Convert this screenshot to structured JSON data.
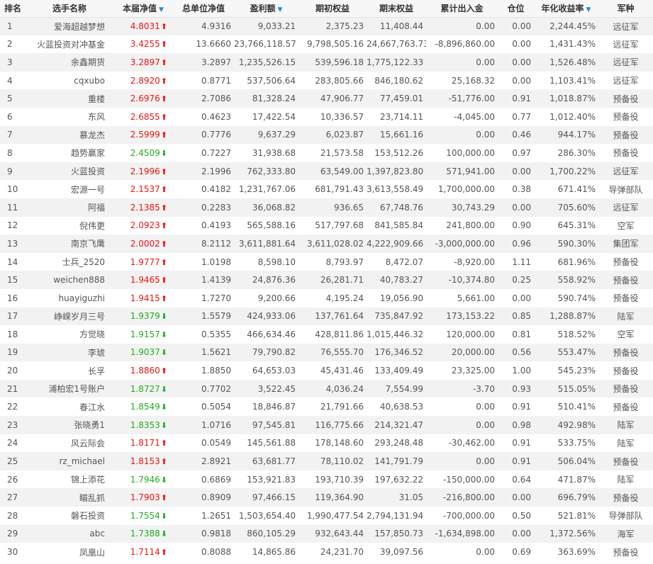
{
  "colors": {
    "up": "#ee1111",
    "down": "#22aa22",
    "sort_accent": "#1b8be0"
  },
  "headers": [
    {
      "label": "排名",
      "sortable": false
    },
    {
      "label": "选手名称",
      "sortable": false
    },
    {
      "label": "本届净值",
      "sortable": true
    },
    {
      "label": "总单位净值",
      "sortable": false
    },
    {
      "label": "盈利额",
      "sortable": true
    },
    {
      "label": "期初权益",
      "sortable": false
    },
    {
      "label": "期末权益",
      "sortable": false
    },
    {
      "label": "累计出入金",
      "sortable": false
    },
    {
      "label": "仓位",
      "sortable": false
    },
    {
      "label": "年化收益率",
      "sortable": true
    },
    {
      "label": "军种",
      "sortable": false
    }
  ],
  "rows": [
    {
      "rank": "1",
      "name": "爱海超越梦想",
      "nav": "4.8031",
      "dir": "up",
      "unit_nav": "4.9316",
      "profit": "9,033.21",
      "start_equity": "2,375.23",
      "end_equity": "11,408.44",
      "cum_flow": "0.00",
      "position": "0.00",
      "annual_return": "2,244.45%",
      "army": "远征军"
    },
    {
      "rank": "2",
      "name": "火蓝投资对冲基金",
      "nav": "3.4255",
      "dir": "up",
      "unit_nav": "13.6660",
      "profit": "23,766,118.57",
      "start_equity": "9,798,505.16",
      "end_equity": "24,667,763.73",
      "cum_flow": "-8,896,860.00",
      "position": "0.00",
      "annual_return": "1,431.43%",
      "army": "远征军"
    },
    {
      "rank": "3",
      "name": "余鑫期货",
      "nav": "3.2897",
      "dir": "up",
      "unit_nav": "3.2897",
      "profit": "1,235,526.15",
      "start_equity": "539,596.18",
      "end_equity": "1,775,122.33",
      "cum_flow": "0.00",
      "position": "0.00",
      "annual_return": "1,526.48%",
      "army": "远征军"
    },
    {
      "rank": "4",
      "name": "cqxubo",
      "nav": "2.8920",
      "dir": "up",
      "unit_nav": "0.8771",
      "profit": "537,506.64",
      "start_equity": "283,805.66",
      "end_equity": "846,180.62",
      "cum_flow": "25,168.32",
      "position": "0.00",
      "annual_return": "1,103.41%",
      "army": "远征军"
    },
    {
      "rank": "5",
      "name": "重楼",
      "nav": "2.6976",
      "dir": "up",
      "unit_nav": "2.7086",
      "profit": "81,328.24",
      "start_equity": "47,906.77",
      "end_equity": "77,459.01",
      "cum_flow": "-51,776.00",
      "position": "0.91",
      "annual_return": "1,018.87%",
      "army": "预备役"
    },
    {
      "rank": "6",
      "name": "东风",
      "nav": "2.6855",
      "dir": "up",
      "unit_nav": "0.4623",
      "profit": "17,422.54",
      "start_equity": "10,336.57",
      "end_equity": "23,714.11",
      "cum_flow": "-4,045.00",
      "position": "0.77",
      "annual_return": "1,012.40%",
      "army": "预备役"
    },
    {
      "rank": "7",
      "name": "慕龙杰",
      "nav": "2.5999",
      "dir": "up",
      "unit_nav": "0.7776",
      "profit": "9,637.29",
      "start_equity": "6,023.87",
      "end_equity": "15,661.16",
      "cum_flow": "0.00",
      "position": "0.46",
      "annual_return": "944.17%",
      "army": "预备役"
    },
    {
      "rank": "8",
      "name": "趋势赢家",
      "nav": "2.4509",
      "dir": "down",
      "unit_nav": "0.7227",
      "profit": "31,938.68",
      "start_equity": "21,573.58",
      "end_equity": "153,512.26",
      "cum_flow": "100,000.00",
      "position": "0.97",
      "annual_return": "286.30%",
      "army": "预备役"
    },
    {
      "rank": "9",
      "name": "火蓝投资",
      "nav": "2.1996",
      "dir": "up",
      "unit_nav": "2.1996",
      "profit": "762,333.80",
      "start_equity": "63,549.00",
      "end_equity": "1,397,823.80",
      "cum_flow": "571,941.00",
      "position": "0.00",
      "annual_return": "1,700.22%",
      "army": "远征军"
    },
    {
      "rank": "10",
      "name": "宏源一号",
      "nav": "2.1537",
      "dir": "up",
      "unit_nav": "0.4182",
      "profit": "1,231,767.06",
      "start_equity": "681,791.43",
      "end_equity": "3,613,558.49",
      "cum_flow": "1,700,000.00",
      "position": "0.38",
      "annual_return": "671.41%",
      "army": "导弹部队"
    },
    {
      "rank": "11",
      "name": "阿福",
      "nav": "2.1385",
      "dir": "up",
      "unit_nav": "0.2283",
      "profit": "36,068.82",
      "start_equity": "936.65",
      "end_equity": "67,748.76",
      "cum_flow": "30,743.29",
      "position": "0.00",
      "annual_return": "705.60%",
      "army": "远征军"
    },
    {
      "rank": "12",
      "name": "倪伟更",
      "nav": "2.0923",
      "dir": "up",
      "unit_nav": "0.4193",
      "profit": "565,588.16",
      "start_equity": "517,797.68",
      "end_equity": "841,585.84",
      "cum_flow": "241,800.00",
      "position": "0.90",
      "annual_return": "645.31%",
      "army": "空军"
    },
    {
      "rank": "13",
      "name": "南京飞鹰",
      "nav": "2.0002",
      "dir": "up",
      "unit_nav": "8.2112",
      "profit": "3,611,881.64",
      "start_equity": "3,611,028.02",
      "end_equity": "4,222,909.66",
      "cum_flow": "-3,000,000.00",
      "position": "0.96",
      "annual_return": "590.30%",
      "army": "集团军"
    },
    {
      "rank": "14",
      "name": "士兵_2520",
      "nav": "1.9777",
      "dir": "up",
      "unit_nav": "1.0198",
      "profit": "8,598.10",
      "start_equity": "8,793.97",
      "end_equity": "8,472.07",
      "cum_flow": "-8,920.00",
      "position": "1.11",
      "annual_return": "681.96%",
      "army": "预备役"
    },
    {
      "rank": "15",
      "name": "weichen888",
      "nav": "1.9465",
      "dir": "up",
      "unit_nav": "1.4139",
      "profit": "24,876.36",
      "start_equity": "26,281.71",
      "end_equity": "40,783.27",
      "cum_flow": "-10,374.80",
      "position": "0.25",
      "annual_return": "558.92%",
      "army": "预备役"
    },
    {
      "rank": "16",
      "name": "huayiguzhi",
      "nav": "1.9415",
      "dir": "up",
      "unit_nav": "1.7270",
      "profit": "9,200.66",
      "start_equity": "4,195.24",
      "end_equity": "19,056.90",
      "cum_flow": "5,661.00",
      "position": "0.00",
      "annual_return": "590.74%",
      "army": "预备役"
    },
    {
      "rank": "17",
      "name": "峥嵘岁月三号",
      "nav": "1.9379",
      "dir": "down",
      "unit_nav": "1.5579",
      "profit": "424,933.06",
      "start_equity": "137,761.64",
      "end_equity": "735,847.92",
      "cum_flow": "173,153.22",
      "position": "0.85",
      "annual_return": "1,288.87%",
      "army": "陆军"
    },
    {
      "rank": "18",
      "name": "方觉晓",
      "nav": "1.9157",
      "dir": "down",
      "unit_nav": "0.5355",
      "profit": "466,634.46",
      "start_equity": "428,811.86",
      "end_equity": "1,015,446.32",
      "cum_flow": "120,000.00",
      "position": "0.81",
      "annual_return": "518.52%",
      "army": "空军"
    },
    {
      "rank": "19",
      "name": "李琥",
      "nav": "1.9037",
      "dir": "down",
      "unit_nav": "1.5621",
      "profit": "79,790.82",
      "start_equity": "76,555.70",
      "end_equity": "176,346.52",
      "cum_flow": "20,000.00",
      "position": "0.56",
      "annual_return": "553.47%",
      "army": "预备役"
    },
    {
      "rank": "20",
      "name": "长孚",
      "nav": "1.8860",
      "dir": "up",
      "unit_nav": "1.8850",
      "profit": "64,653.03",
      "start_equity": "45,431.46",
      "end_equity": "133,409.49",
      "cum_flow": "23,325.00",
      "position": "1.00",
      "annual_return": "545.23%",
      "army": "预备役"
    },
    {
      "rank": "21",
      "name": "浦柏宏1号账户",
      "nav": "1.8727",
      "dir": "down",
      "unit_nav": "0.7702",
      "profit": "3,522.45",
      "start_equity": "4,036.24",
      "end_equity": "7,554.99",
      "cum_flow": "-3.70",
      "position": "0.93",
      "annual_return": "515.05%",
      "army": "预备役"
    },
    {
      "rank": "22",
      "name": "春江水",
      "nav": "1.8549",
      "dir": "down",
      "unit_nav": "0.5054",
      "profit": "18,846.87",
      "start_equity": "21,791.66",
      "end_equity": "40,638.53",
      "cum_flow": "0.00",
      "position": "0.91",
      "annual_return": "510.41%",
      "army": "预备役"
    },
    {
      "rank": "23",
      "name": "张晓勇1",
      "nav": "1.8353",
      "dir": "down",
      "unit_nav": "1.0716",
      "profit": "97,545.81",
      "start_equity": "116,775.66",
      "end_equity": "214,321.47",
      "cum_flow": "0.00",
      "position": "0.98",
      "annual_return": "492.98%",
      "army": "陆军"
    },
    {
      "rank": "24",
      "name": "风云际会",
      "nav": "1.8171",
      "dir": "up",
      "unit_nav": "0.0549",
      "profit": "145,561.88",
      "start_equity": "178,148.60",
      "end_equity": "293,248.48",
      "cum_flow": "-30,462.00",
      "position": "0.91",
      "annual_return": "533.75%",
      "army": "陆军"
    },
    {
      "rank": "25",
      "name": "rz_michael",
      "nav": "1.8153",
      "dir": "up",
      "unit_nav": "2.8921",
      "profit": "63,681.77",
      "start_equity": "78,110.02",
      "end_equity": "141,791.79",
      "cum_flow": "0.00",
      "position": "0.91",
      "annual_return": "506.04%",
      "army": "预备役"
    },
    {
      "rank": "26",
      "name": "锦上添花",
      "nav": "1.7946",
      "dir": "down",
      "unit_nav": "0.6869",
      "profit": "153,921.83",
      "start_equity": "193,710.39",
      "end_equity": "197,632.22",
      "cum_flow": "-150,000.00",
      "position": "0.64",
      "annual_return": "471.87%",
      "army": "陆军"
    },
    {
      "rank": "27",
      "name": "瞄乱抓",
      "nav": "1.7903",
      "dir": "up",
      "unit_nav": "0.8909",
      "profit": "97,466.15",
      "start_equity": "119,364.90",
      "end_equity": "31.05",
      "cum_flow": "-216,800.00",
      "position": "0.00",
      "annual_return": "696.79%",
      "army": "预备役"
    },
    {
      "rank": "28",
      "name": "磐石投资",
      "nav": "1.7554",
      "dir": "down",
      "unit_nav": "1.2651",
      "profit": "1,503,654.40",
      "start_equity": "1,990,477.54",
      "end_equity": "2,794,131.94",
      "cum_flow": "-700,000.00",
      "position": "0.50",
      "annual_return": "521.81%",
      "army": "导弹部队"
    },
    {
      "rank": "29",
      "name": "abc",
      "nav": "1.7388",
      "dir": "down",
      "unit_nav": "0.9818",
      "profit": "860,105.29",
      "start_equity": "932,643.44",
      "end_equity": "157,850.73",
      "cum_flow": "-1,634,898.00",
      "position": "0.00",
      "annual_return": "1,372.56%",
      "army": "海军"
    },
    {
      "rank": "30",
      "name": "凤凰山",
      "nav": "1.7114",
      "dir": "up",
      "unit_nav": "0.8088",
      "profit": "14,865.86",
      "start_equity": "24,231.70",
      "end_equity": "39,097.56",
      "cum_flow": "0.00",
      "position": "0.69",
      "annual_return": "363.69%",
      "army": "预备役"
    }
  ]
}
